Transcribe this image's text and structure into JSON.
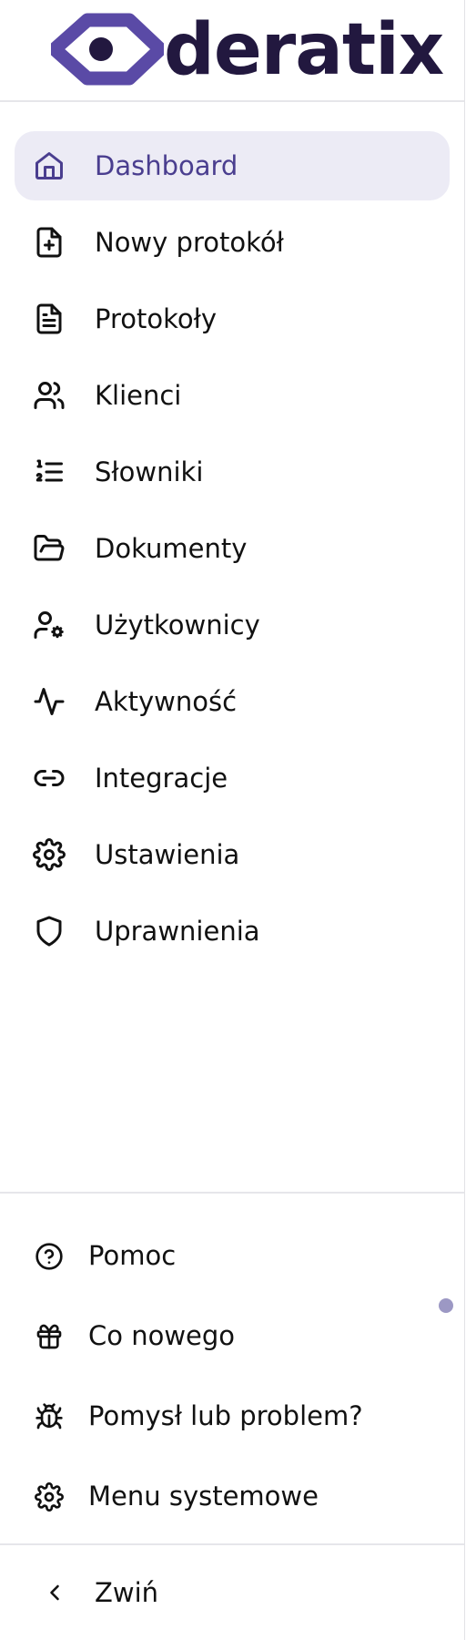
{
  "brand": {
    "name": "deratix",
    "accent": "#4a3e8f",
    "logo_color": "#5a4aa6"
  },
  "nav": {
    "items": [
      {
        "label": "Dashboard",
        "icon": "home-icon",
        "active": true
      },
      {
        "label": "Nowy protokół",
        "icon": "file-plus-icon"
      },
      {
        "label": "Protokoły",
        "icon": "file-text-icon"
      },
      {
        "label": "Klienci",
        "icon": "users-icon"
      },
      {
        "label": "Słowniki",
        "icon": "list-ordered-icon"
      },
      {
        "label": "Dokumenty",
        "icon": "folder-open-icon"
      },
      {
        "label": "Użytkownicy",
        "icon": "user-cog-icon"
      },
      {
        "label": "Aktywność",
        "icon": "activity-icon"
      },
      {
        "label": "Integracje",
        "icon": "link-icon"
      },
      {
        "label": "Ustawienia",
        "icon": "settings-icon"
      },
      {
        "label": "Uprawnienia",
        "icon": "shield-icon"
      }
    ]
  },
  "footer": {
    "items": [
      {
        "label": "Pomoc",
        "icon": "help-circle-icon"
      },
      {
        "label": "Co nowego",
        "icon": "gift-icon",
        "notification": true
      },
      {
        "label": "Pomysł lub problem?",
        "icon": "bug-icon"
      },
      {
        "label": "Menu systemowe",
        "icon": "settings-icon"
      }
    ],
    "collapse_label": "Zwiń",
    "collapse_icon": "chevron-left-icon"
  }
}
